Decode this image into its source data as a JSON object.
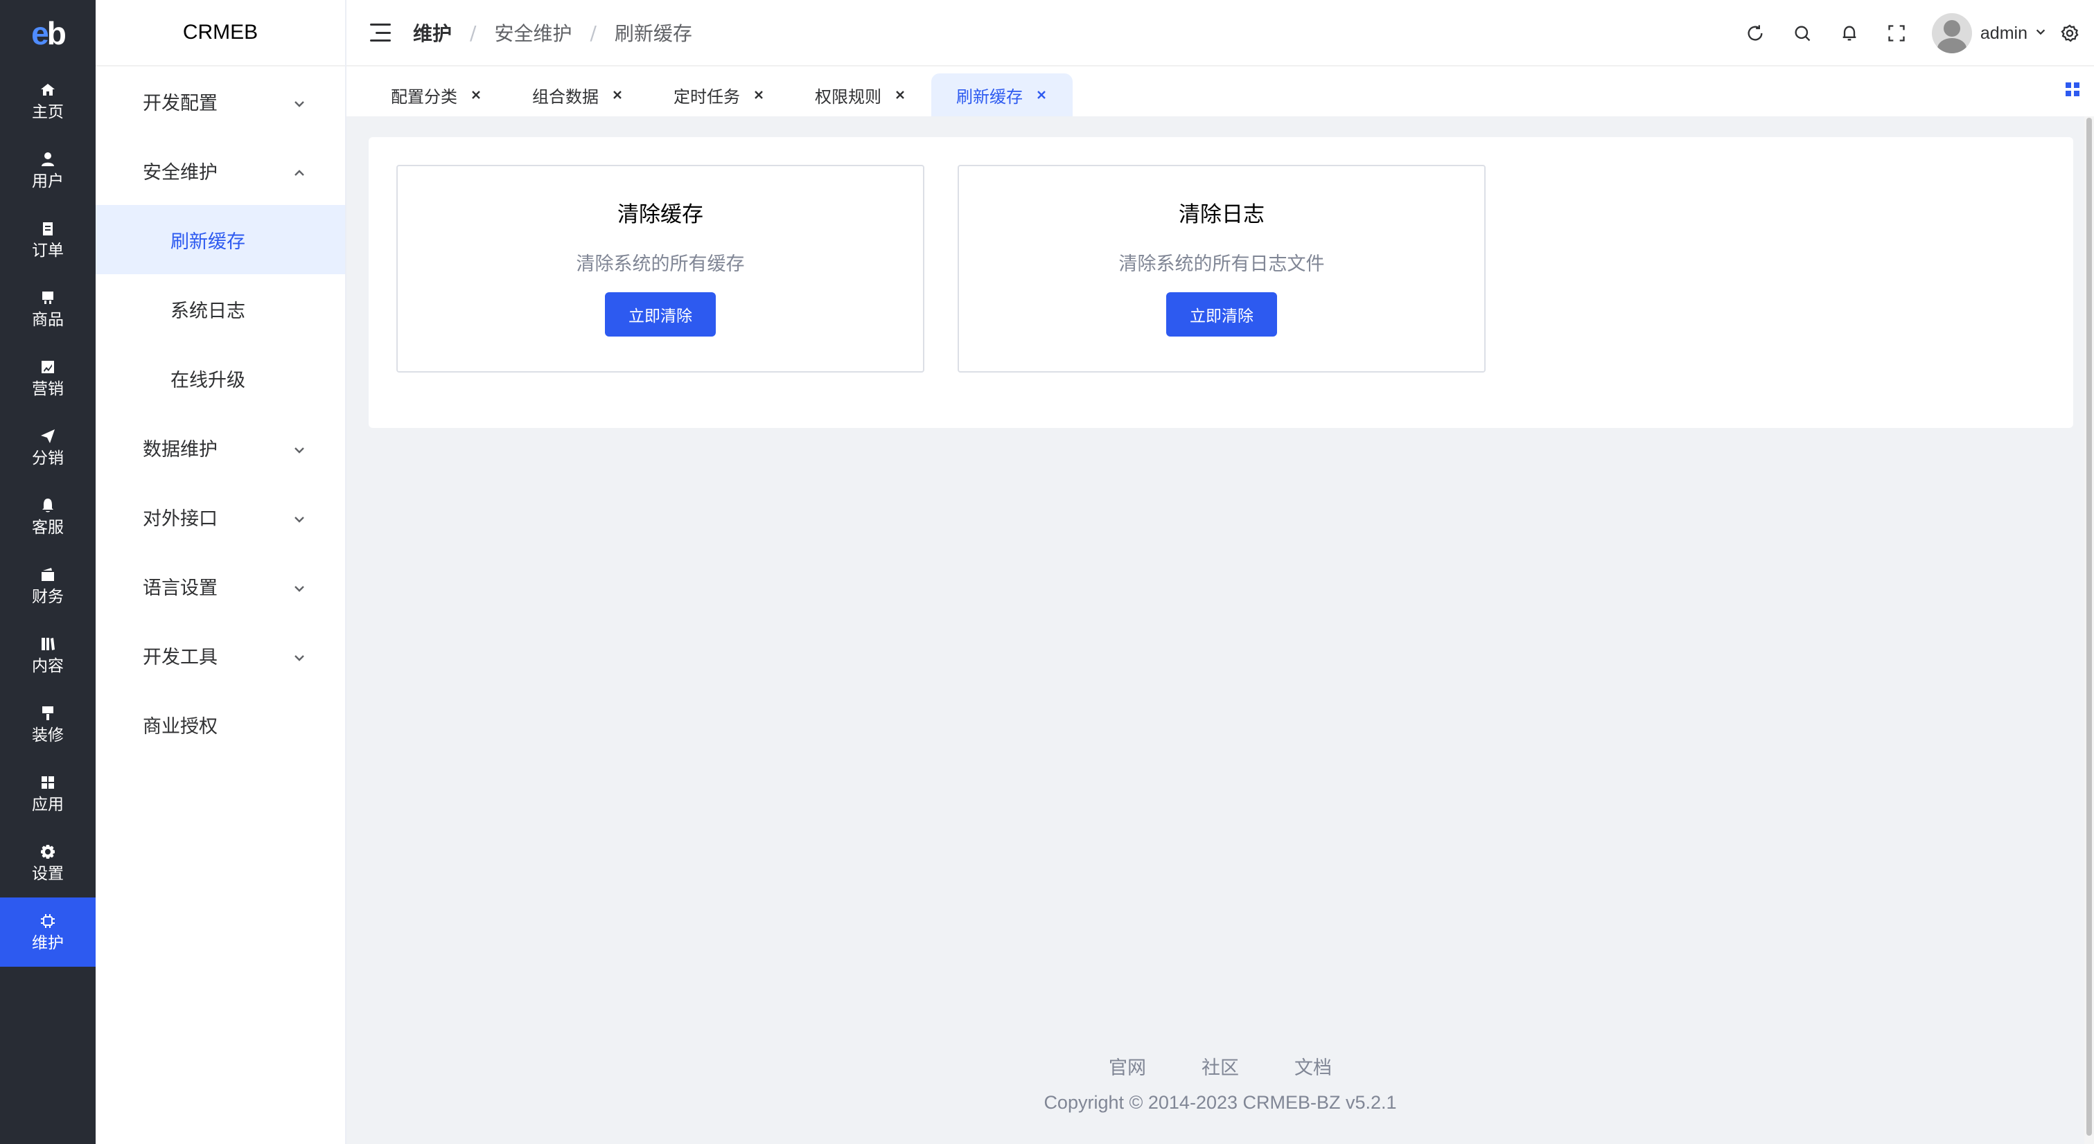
{
  "brand": {
    "logo_e": "e",
    "logo_b": "b",
    "name": "CRMEB"
  },
  "rail": {
    "items": [
      {
        "label": "主页",
        "icon": "home-icon"
      },
      {
        "label": "用户",
        "icon": "user-icon"
      },
      {
        "label": "订单",
        "icon": "clipboard-icon"
      },
      {
        "label": "商品",
        "icon": "product-icon"
      },
      {
        "label": "营销",
        "icon": "chart-icon"
      },
      {
        "label": "分销",
        "icon": "send-icon"
      },
      {
        "label": "客服",
        "icon": "bell-icon"
      },
      {
        "label": "财务",
        "icon": "wallet-icon"
      },
      {
        "label": "内容",
        "icon": "book-icon"
      },
      {
        "label": "装修",
        "icon": "brush-icon"
      },
      {
        "label": "应用",
        "icon": "apps-icon"
      },
      {
        "label": "设置",
        "icon": "gear-icon"
      },
      {
        "label": "维护",
        "icon": "chip-icon"
      }
    ],
    "active": "维护"
  },
  "submenu": {
    "groups": [
      {
        "label": "开发配置",
        "expanded": false
      },
      {
        "label": "安全维护",
        "expanded": true,
        "children": [
          "刷新缓存",
          "系统日志",
          "在线升级"
        ],
        "active_child": "刷新缓存"
      },
      {
        "label": "数据维护",
        "expanded": false
      },
      {
        "label": "对外接口",
        "expanded": false
      },
      {
        "label": "语言设置",
        "expanded": false
      },
      {
        "label": "开发工具",
        "expanded": false
      },
      {
        "label": "商业授权",
        "expanded": null
      }
    ]
  },
  "header": {
    "breadcrumb": [
      "维护",
      "安全维护",
      "刷新缓存"
    ],
    "separator": "/",
    "user": "admin"
  },
  "tabs": {
    "items": [
      "配置分类",
      "组合数据",
      "定时任务",
      "权限规则",
      "刷新缓存"
    ],
    "active": "刷新缓存"
  },
  "cards": [
    {
      "title": "清除缓存",
      "desc": "清除系统的所有缓存",
      "button": "立即清除"
    },
    {
      "title": "清除日志",
      "desc": "清除系统的所有日志文件",
      "button": "立即清除"
    }
  ],
  "footer": {
    "links": [
      "官网",
      "社区",
      "文档"
    ],
    "copyright": "Copyright © 2014-2023 CRMEB-BZ v5.2.1"
  },
  "colors": {
    "primary": "#2d5af0",
    "rail_bg": "#282c34",
    "page_bg": "#f0f2f5"
  }
}
